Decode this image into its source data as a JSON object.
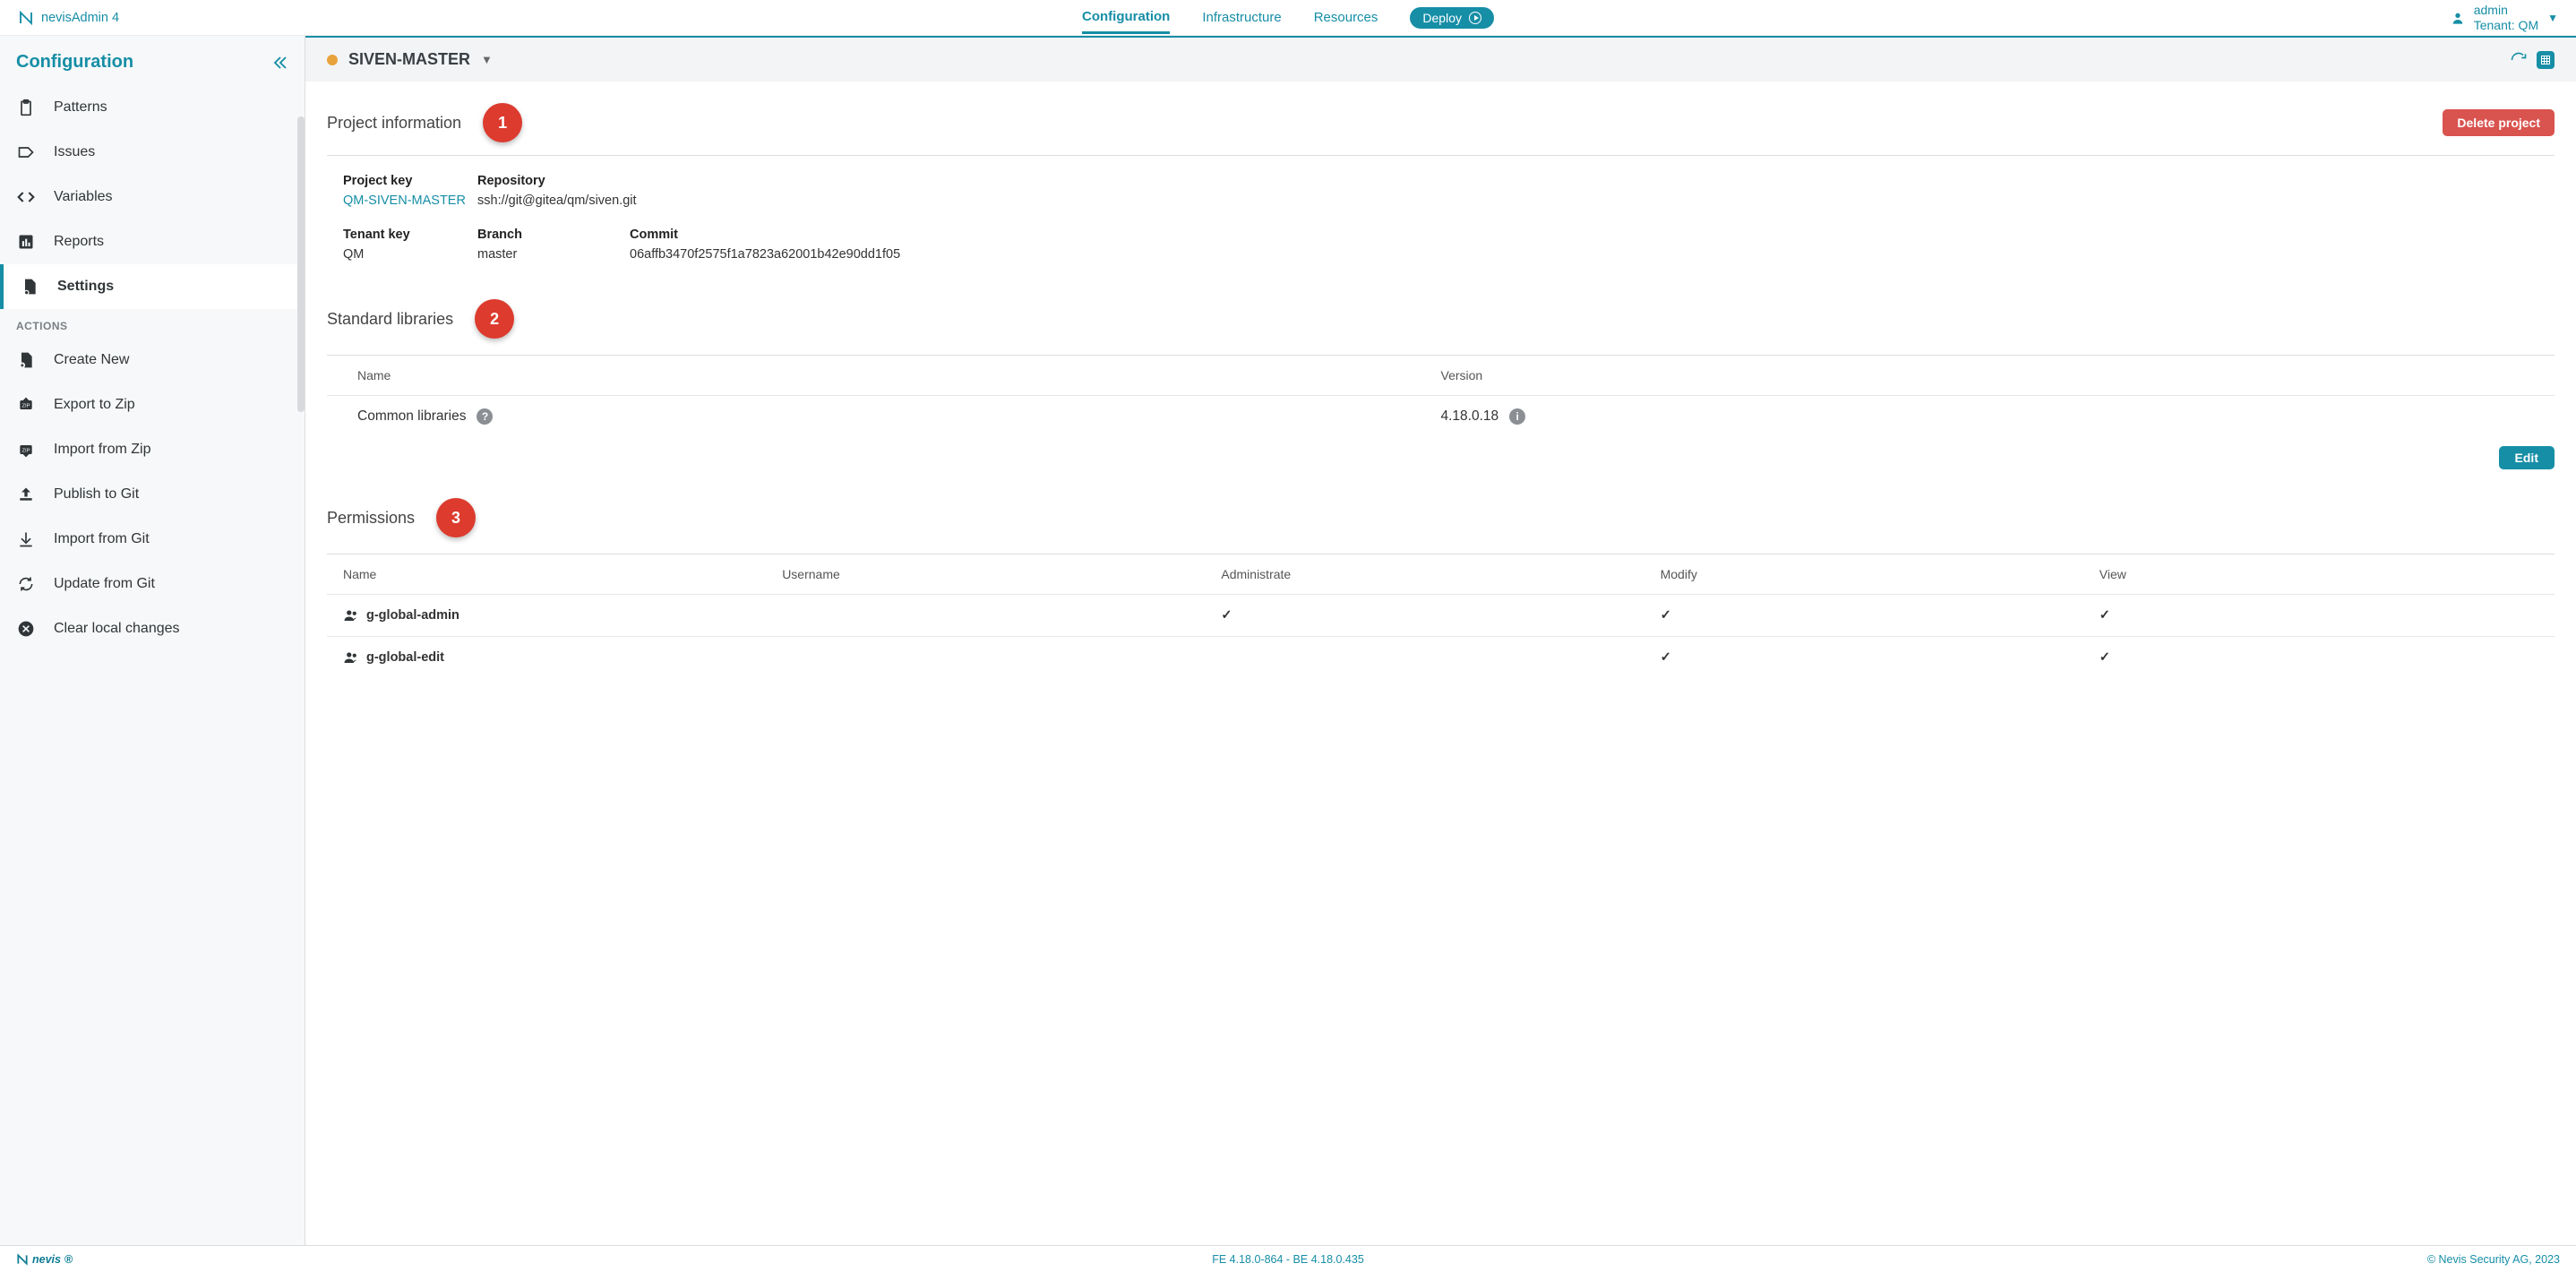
{
  "brand": "nevisAdmin 4",
  "topnav": {
    "configuration": "Configuration",
    "infrastructure": "Infrastructure",
    "resources": "Resources",
    "deploy": "Deploy"
  },
  "user": {
    "name": "admin",
    "tenant": "Tenant: QM"
  },
  "sidebar": {
    "title": "Configuration",
    "items": [
      "Patterns",
      "Issues",
      "Variables",
      "Reports",
      "Settings"
    ],
    "actions_label": "ACTIONS",
    "actions": [
      "Create New",
      "Export to Zip",
      "Import from Zip",
      "Publish to Git",
      "Import from Git",
      "Update from Git",
      "Clear local changes"
    ]
  },
  "project": {
    "name": "SIVEN-MASTER",
    "info_title": "Project information",
    "delete_label": "Delete project",
    "labels": {
      "key": "Project key",
      "repo": "Repository",
      "tenant": "Tenant key",
      "branch": "Branch",
      "commit": "Commit"
    },
    "key": "QM-SIVEN-MASTER",
    "repo": "ssh://git@gitea/qm/siven.git",
    "tenant": "QM",
    "branch": "master",
    "commit": "06affb3470f2575f1a7823a62001b42e90dd1f05"
  },
  "callouts": {
    "c1": "1",
    "c2": "2",
    "c3": "3"
  },
  "libraries": {
    "title": "Standard libraries",
    "headers": {
      "name": "Name",
      "version": "Version"
    },
    "rows": [
      {
        "name": "Common libraries",
        "version": "4.18.0.18"
      }
    ],
    "edit": "Edit"
  },
  "permissions": {
    "title": "Permissions",
    "headers": {
      "name": "Name",
      "username": "Username",
      "admin": "Administrate",
      "modify": "Modify",
      "view": "View"
    },
    "rows": [
      {
        "name": "g-global-admin",
        "admin": true,
        "modify": true,
        "view": true
      },
      {
        "name": "g-global-edit",
        "admin": false,
        "modify": true,
        "view": true
      }
    ]
  },
  "footer": {
    "brand": "nevis",
    "version": "FE 4.18.0-864 - BE 4.18.0.435",
    "copyright": "© Nevis Security AG, 2023"
  }
}
